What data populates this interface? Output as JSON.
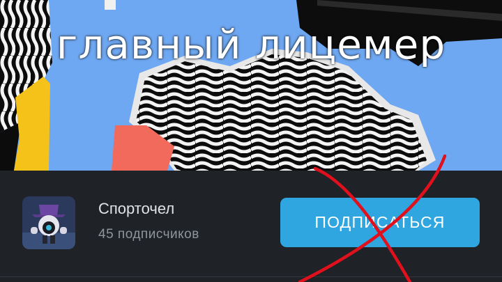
{
  "banner": {
    "overlay_text": "главный лицемер"
  },
  "channel": {
    "name": "Спорточел",
    "subscribers": "45 подписчиков",
    "avatar_icon": "avatar-character-icon"
  },
  "actions": {
    "subscribe_label": "ПОДПИСАТЬСЯ"
  },
  "colors": {
    "background": "#1f2227",
    "button": "#2fa6df",
    "banner_blue": "#6fa8f2",
    "cross_red": "#e0101c"
  }
}
